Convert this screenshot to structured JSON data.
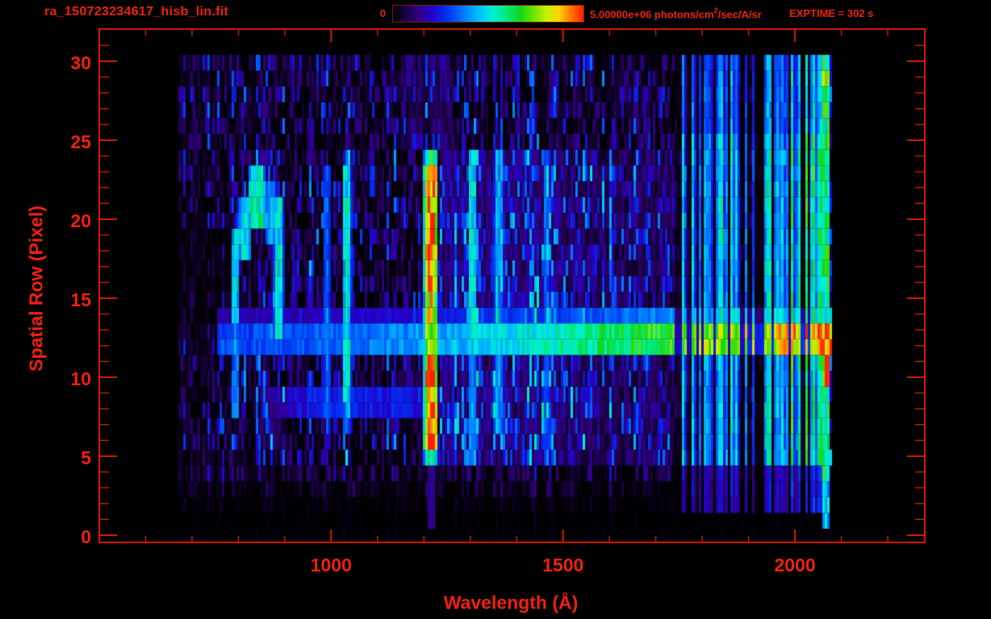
{
  "colors": {
    "background": "#000000",
    "text": "#f02010",
    "axis_line": "#d01800",
    "colorbar_border": "#7c1c08"
  },
  "header": {
    "title": "ra_150723234617_hisb_lin.fit",
    "colorbar": {
      "min_label": "0",
      "max_value": "5.00000e+06",
      "units_before_sup": " photons/cm",
      "units_sup": "2",
      "units_after_sup": "/sec/A/sr"
    },
    "exptime_label": "EXPTIME = 302 s"
  },
  "chart_data": {
    "type": "heatmap",
    "title": "ra_150723234617_hisb_lin.fit",
    "xlabel": "Wavelength (Å)",
    "ylabel": "Spatial Row (Pixel)",
    "xlim": [
      500,
      2280
    ],
    "ylim": [
      -0.46,
      32.04
    ],
    "x_ticks": {
      "major": [
        1000,
        1500,
        2000
      ],
      "minor_start": 600,
      "minor_end": 2200,
      "minor_step": 100
    },
    "y_ticks": {
      "major": [
        0,
        5,
        10,
        15,
        20,
        25,
        30
      ],
      "minor_start": 1,
      "minor_end": 31,
      "minor_step": 1
    },
    "colorbar": {
      "min": 0,
      "max": 5000000,
      "min_label": "0",
      "max_label": "5.00000e+06",
      "units": "photons/cm^2/sec/A/sr"
    },
    "exposure_time_s": 302,
    "data_extent": {
      "lam": [
        670,
        2080
      ],
      "rows": [
        0,
        30
      ]
    },
    "colormap": [
      [
        0.0,
        "#000000"
      ],
      [
        0.06,
        "#16003c"
      ],
      [
        0.13,
        "#31007c"
      ],
      [
        0.2,
        "#2400c8"
      ],
      [
        0.28,
        "#0030f0"
      ],
      [
        0.36,
        "#0070ff"
      ],
      [
        0.44,
        "#00b8ff"
      ],
      [
        0.52,
        "#00f0d8"
      ],
      [
        0.6,
        "#00e878"
      ],
      [
        0.67,
        "#10d818"
      ],
      [
        0.74,
        "#70e400"
      ],
      [
        0.81,
        "#c8f000"
      ],
      [
        0.87,
        "#ffd400"
      ],
      [
        0.93,
        "#ff7c00"
      ],
      [
        1.0,
        "#ff1e00"
      ]
    ],
    "features": [
      {
        "name": "dark-hole-left",
        "kind": "dim",
        "lam": [
          640,
          788
        ],
        "rows": [
          14,
          19
        ],
        "i": 0.45
      },
      {
        "name": "dim-far-left",
        "kind": "dim",
        "lam": [
          660,
          762
        ],
        "rows": [
          5,
          24
        ],
        "i": 0.7
      },
      {
        "name": "diffuse-1240-1500",
        "kind": "diffuse",
        "lam": [
          1235,
          1505
        ],
        "rows": [
          5,
          24
        ],
        "i": 0.1
      },
      {
        "name": "diffuse-1505-1800",
        "kind": "diffuse",
        "lam": [
          1505,
          1800
        ],
        "rows": [
          5,
          24
        ],
        "i": 0.065
      },
      {
        "name": "diffuse-above-lya",
        "kind": "diffuse",
        "lam": [
          1150,
          1265
        ],
        "rows": [
          25,
          30
        ],
        "i": 0.06
      },
      {
        "name": "lyman-alpha-emission",
        "kind": "seg",
        "lam": [
          1200,
          1231
        ],
        "rows": [
          5,
          24
        ],
        "i": 0.97,
        "rowmap": [
          [
            5,
            5,
            0.62
          ],
          [
            6,
            11,
            1.0
          ],
          [
            12,
            16,
            0.85
          ],
          [
            17,
            23,
            1.0
          ],
          [
            24,
            24,
            0.66
          ]
        ]
      },
      {
        "name": "lyman-alpha-tail",
        "kind": "seg",
        "lam": [
          1208,
          1224
        ],
        "rows": [
          1,
          4
        ],
        "i": 0.17
      },
      {
        "name": "airglow-line-1030",
        "kind": "seg",
        "lam": [
          1024,
          1044
        ],
        "rows": [
          7,
          24
        ],
        "i": 0.5,
        "rowmap": [
          [
            7,
            8,
            0.65
          ],
          [
            24,
            24,
            0.6
          ]
        ]
      },
      {
        "name": "airglow-line-990",
        "kind": "seg",
        "lam": [
          983,
          999
        ],
        "rows": [
          8,
          23
        ],
        "i": 0.33
      },
      {
        "name": "airglow-line-1304",
        "kind": "seg",
        "lam": [
          1295,
          1314
        ],
        "rows": [
          5,
          24
        ],
        "i": 0.5,
        "rowmap": [
          [
            5,
            11,
            0.8
          ]
        ]
      },
      {
        "name": "airglow-line-1356",
        "kind": "seg",
        "lam": [
          1350,
          1373
        ],
        "rows": [
          7,
          24
        ],
        "i": 0.4
      },
      {
        "name": "airglow-line-1464",
        "kind": "seg",
        "lam": [
          1457,
          1473
        ],
        "rows": [
          5,
          24
        ],
        "i": 0.33
      },
      {
        "name": "hook-left-arm",
        "kind": "seg",
        "lam": [
          785,
          802
        ],
        "rows": [
          8,
          19
        ],
        "i": 0.5,
        "rowmap": [
          [
            8,
            13,
            0.75
          ]
        ]
      },
      {
        "name": "hook-top-1",
        "kind": "seg",
        "lam": [
          797,
          828
        ],
        "rows": [
          18,
          21
        ],
        "i": 0.46
      },
      {
        "name": "hook-top-2",
        "kind": "seg",
        "lam": [
          820,
          860
        ],
        "rows": [
          20,
          23
        ],
        "i": 0.55
      },
      {
        "name": "hook-right-upper",
        "kind": "seg",
        "lam": [
          856,
          882
        ],
        "rows": [
          19,
          22
        ],
        "i": 0.42
      },
      {
        "name": "hook-right-arm",
        "kind": "seg",
        "lam": [
          874,
          898
        ],
        "rows": [
          13,
          21
        ],
        "i": 0.5
      },
      {
        "name": "row-8-9-blue-band",
        "kind": "seg",
        "lam": [
          856,
          1255
        ],
        "rows": [
          8,
          9
        ],
        "i": 0.24
      },
      {
        "name": "source-trace",
        "kind": "trace",
        "lam": [
          756,
          2078
        ],
        "rows": [
          12,
          14
        ],
        "i0": 0.3,
        "i1": 0.93,
        "rowmap": [
          [
            14,
            14,
            0.55
          ]
        ]
      },
      {
        "name": "right-green-region",
        "kind": "columns",
        "lam": [
          1742,
          2057
        ],
        "rows": [
          2,
          30
        ],
        "i": 1.0,
        "rowmap": [
          [
            2,
            4,
            0.45
          ],
          [
            26,
            30,
            0.8
          ]
        ]
      },
      {
        "name": "detector-red-edge",
        "kind": "edge",
        "lam": [
          2057,
          2074
        ],
        "rows": [
          1,
          30
        ],
        "i": 0.72,
        "rowmap": [
          [
            10,
            12,
            1.55
          ],
          [
            27,
            29,
            1.25
          ],
          [
            1,
            3,
            0.8
          ]
        ]
      },
      {
        "name": "sparse-beyond-edge",
        "kind": "sparse",
        "lam": [
          2075,
          2122
        ],
        "rows": [
          1,
          30
        ],
        "i": 0.16,
        "p": 0.05
      }
    ]
  }
}
